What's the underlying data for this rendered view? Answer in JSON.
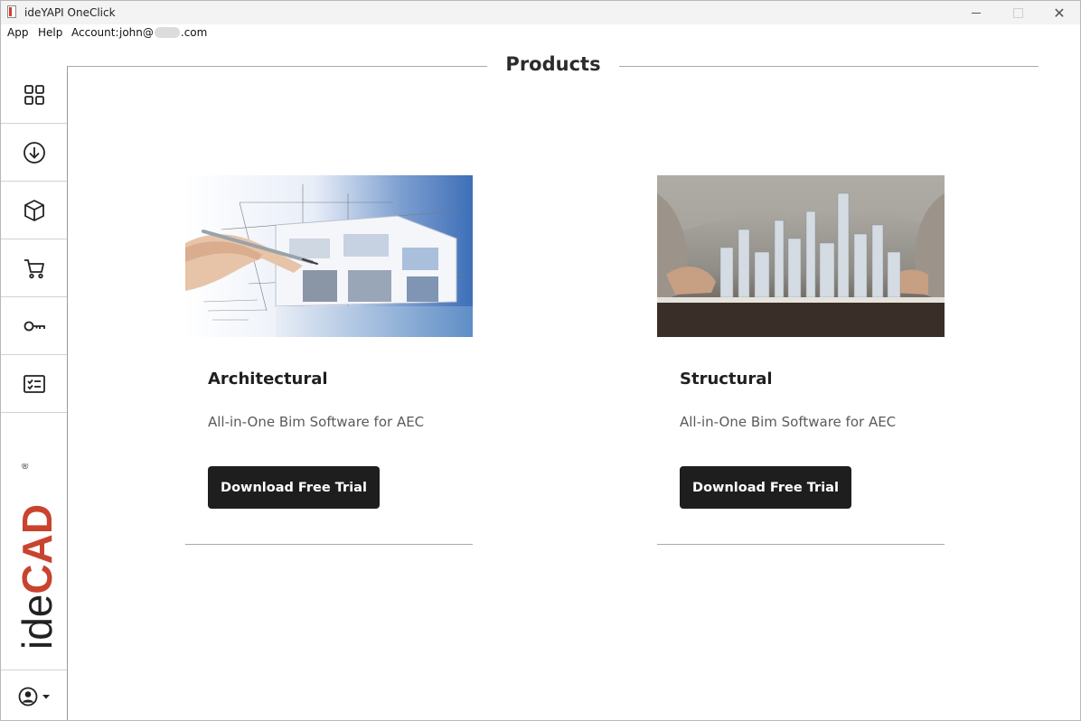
{
  "window": {
    "title": "ideYAPI OneClick"
  },
  "menu": {
    "app": "App",
    "help": "Help",
    "account_label": "Account:",
    "account_email_start": "john@",
    "account_email_end": ".com"
  },
  "sidebar": {
    "items": [
      {
        "icon": "grid-icon"
      },
      {
        "icon": "download-icon"
      },
      {
        "icon": "cube-icon"
      },
      {
        "icon": "cart-icon"
      },
      {
        "icon": "key-icon"
      },
      {
        "icon": "checklist-icon"
      }
    ],
    "brand_light": "ide",
    "brand_bold": "CAD",
    "brand_mark": "®",
    "brand_color": "#c9432f"
  },
  "main": {
    "title": "Products",
    "products": [
      {
        "name": "Architectural",
        "description": "All-in-One Bim Software for AEC",
        "button": "Download Free Trial"
      },
      {
        "name": "Structural",
        "description": "All-in-One Bim Software for AEC",
        "button": "Download Free Trial"
      }
    ]
  }
}
